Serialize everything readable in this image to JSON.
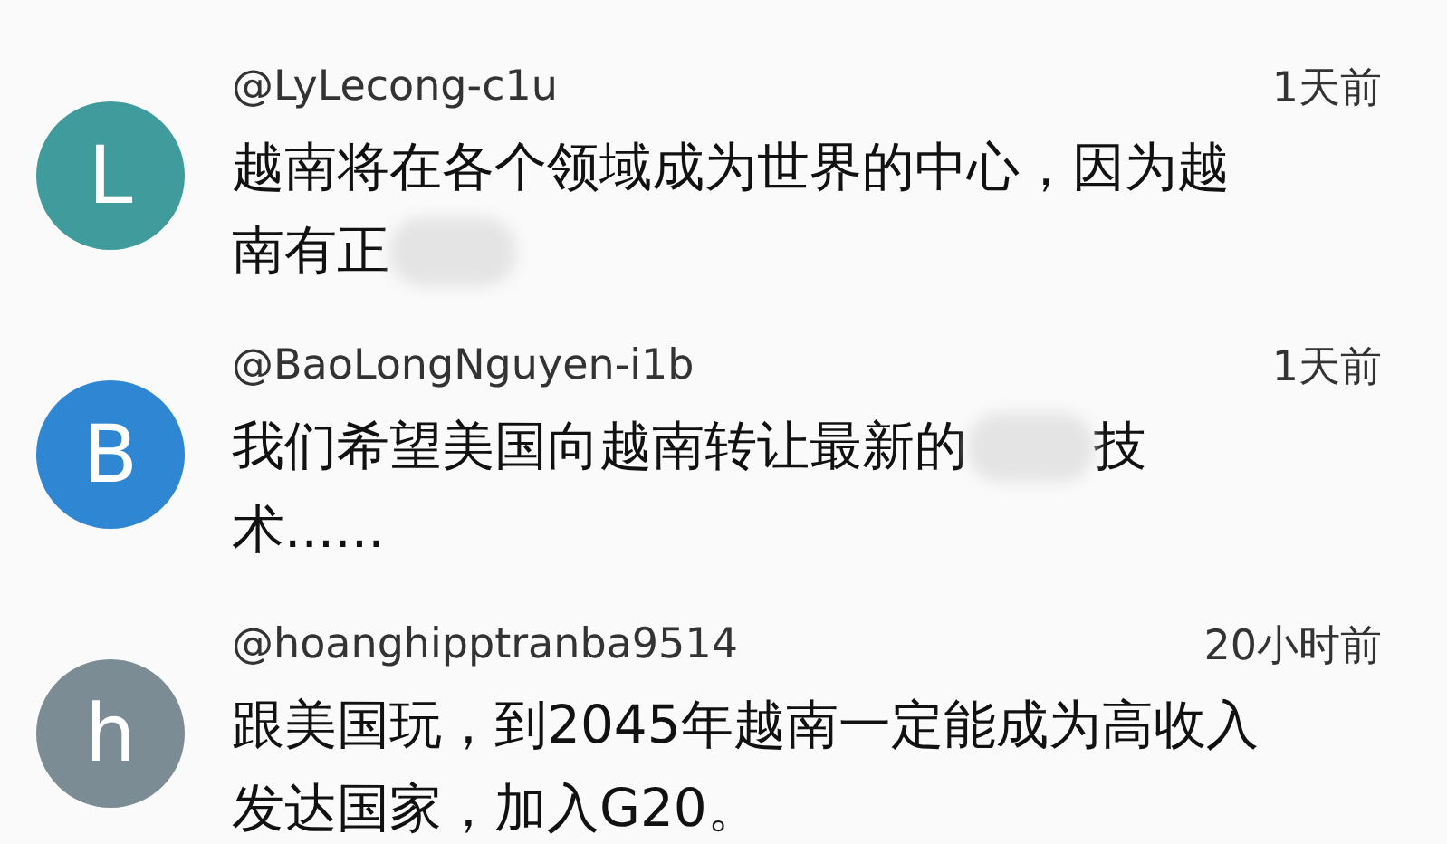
{
  "comments": [
    {
      "avatar": "L",
      "color": "#3f9b9c",
      "user": "@LyLecong-c1u",
      "time": "1天前",
      "lines": [
        {
          "parts": [
            "越南将在各个领域成为世界的中心，因为越"
          ],
          "blurred_end": false
        },
        {
          "parts": [
            "南有正"
          ],
          "blurred_end": true
        }
      ]
    },
    {
      "avatar": "B",
      "color": "#2f86d2",
      "user": "@BaoLongNguyen-i1b",
      "time": "1天前",
      "lines": [
        {
          "parts": [
            "我们希望美国向越南转让最新的",
            "技"
          ],
          "blurred_end": false
        },
        {
          "parts": [
            "术......"
          ],
          "blurred_end": false
        }
      ]
    },
    {
      "avatar": "h",
      "color": "#7b8c94",
      "user": "@hoanghipptranba9514",
      "time": "20小时前",
      "lines": [
        {
          "parts": [
            "跟美国玩，到2045年越南一定能成为高收入"
          ],
          "blurred_end": false
        },
        {
          "parts": [
            "发达国家，加入G20。"
          ],
          "blurred_end": false
        }
      ]
    }
  ]
}
